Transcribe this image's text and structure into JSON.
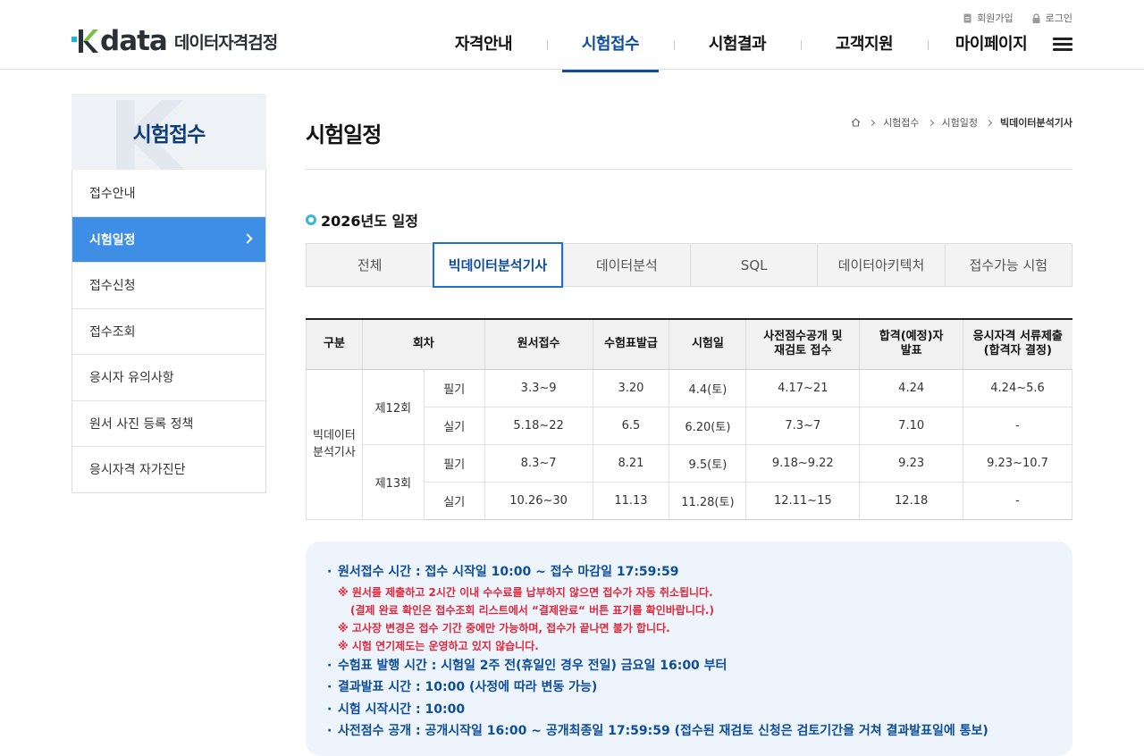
{
  "header": {
    "logo_word": "data",
    "logo_sub": "데이터자격검정",
    "util": {
      "signup": "회원가입",
      "login": "로그인"
    },
    "gnb": [
      "자격안내",
      "시험접수",
      "시험결과",
      "고객지원",
      "마이페이지"
    ]
  },
  "sidebar": {
    "title": "시험접수",
    "items": [
      "접수안내",
      "시험일정",
      "접수신청",
      "접수조회",
      "응시자 유의사항",
      "원서 사진 등록 정책",
      "응시자격 자가진단"
    ]
  },
  "main": {
    "page_title": "시험일정",
    "breadcrumb": [
      "시험접수",
      "시험일정",
      "빅데이터분석기사"
    ],
    "section_title": "2026년도 일정",
    "tabs": [
      "전체",
      "빅데이터분석기사",
      "데이터분석",
      "SQL",
      "데이터아키텍처",
      "접수가능 시험"
    ],
    "table": {
      "headers": {
        "category": "구분",
        "round": "회차",
        "apply": "원서접수",
        "ticket": "수험표발급",
        "exam_date": "시험일",
        "preview_1": "사전점수공개 및",
        "preview_2": "재검토 접수",
        "announce_1": "합격(예정)자",
        "announce_2": "발표",
        "docs_1": "응시자격 서류제출",
        "docs_2": "(합격자 결정)"
      },
      "category": [
        "빅데이터",
        "분석기사"
      ],
      "rounds": [
        {
          "name": "제12회",
          "rows": [
            {
              "type": "필기",
              "apply": "3.3~9",
              "ticket": "3.20",
              "exam": "4.4(토)",
              "preview": "4.17~21",
              "announce": "4.24",
              "docs": "4.24~5.6"
            },
            {
              "type": "실기",
              "apply": "5.18~22",
              "ticket": "6.5",
              "exam": "6.20(토)",
              "preview": "7.3~7",
              "announce": "7.10",
              "docs": "-"
            }
          ]
        },
        {
          "name": "제13회",
          "rows": [
            {
              "type": "필기",
              "apply": "8.3~7",
              "ticket": "8.21",
              "exam": "9.5(토)",
              "preview": "9.18~9.22",
              "announce": "9.23",
              "docs": "9.23~10.7"
            },
            {
              "type": "실기",
              "apply": "10.26~30",
              "ticket": "11.13",
              "exam": "11.28(토)",
              "preview": "12.11~15",
              "announce": "12.18",
              "docs": "-"
            }
          ]
        }
      ]
    },
    "notice": {
      "line1": "원서접수 시간 : 접수 시작일 10:00 ~ 접수 마감일 17:59:59",
      "red1": "※ 원서를 제출하고 2시간 이내 수수료를 납부하지 않으면 접수가 자동 취소됩니다.",
      "red1b": "(결제 완료 확인은 접수조회 리스트에서 “결제완료“ 버튼 표기를 확인바랍니다.)",
      "red2": "※ 고사장 변경은 접수 기간 중에만 가능하며, 접수가 끝나면 불가 합니다.",
      "red3": "※ 시험 연기제도는 운영하고 있지 않습니다.",
      "line2": "수험표 발행 시간 : 시험일 2주 전(휴일인 경우 전일) 금요일 16:00 부터",
      "line3": "결과발표 시간 : 10:00 (사정에 따라 변동 가능)",
      "line4": "시험 시작시간 : 10:00",
      "line5": "사전점수 공개 : 공개시작일 16:00 ~ 공개최종일 17:59:59 (접수된 재검토 신청은 검토기간을 거쳐 결과발표일에 통보)"
    }
  },
  "colors": {
    "brand_blue": "#0d4d9a",
    "sidebar_active": "#3e8ee6",
    "notice_red": "#e0283c",
    "notice_bg": "#edf4fb",
    "logo_green": "#7bc143",
    "logo_cyan": "#1fb5d4"
  }
}
